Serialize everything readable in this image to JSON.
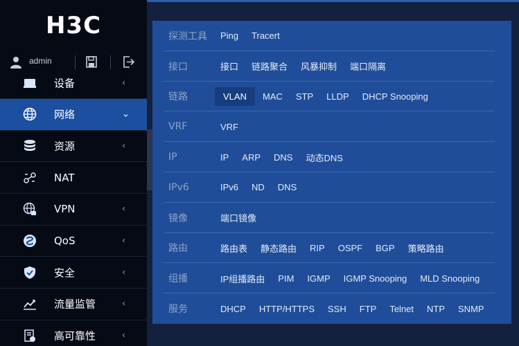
{
  "brand": {
    "logo_text": "H3C"
  },
  "user": {
    "name": "admin",
    "icon": "user-icon",
    "save_icon": "save-icon",
    "logout_icon": "logout-icon"
  },
  "sidebar": {
    "items": [
      {
        "label": "设备",
        "icon": "device-icon",
        "chevron": "‹"
      },
      {
        "label": "网络",
        "icon": "globe-icon",
        "chevron": "⌄",
        "active": true
      },
      {
        "label": "资源",
        "icon": "database-icon",
        "chevron": "‹"
      },
      {
        "label": "NAT",
        "icon": "nat-icon",
        "chevron": ""
      },
      {
        "label": "VPN",
        "icon": "vpn-globe-icon",
        "chevron": "‹"
      },
      {
        "label": "QoS",
        "icon": "qos-icon",
        "chevron": "‹"
      },
      {
        "label": "安全",
        "icon": "shield-icon",
        "chevron": "‹"
      },
      {
        "label": "流量监管",
        "icon": "traffic-chart-icon",
        "chevron": "‹"
      },
      {
        "label": "高可靠性",
        "icon": "reliability-icon",
        "chevron": "‹"
      }
    ]
  },
  "panel": {
    "rows": [
      {
        "label": "探测工具",
        "items": [
          "Ping",
          "Tracert"
        ]
      },
      {
        "label": "接口",
        "items": [
          "接口",
          "链路聚合",
          "风暴抑制",
          "端口隔离"
        ]
      },
      {
        "label": "链路",
        "items": [
          "VLAN",
          "MAC",
          "STP",
          "LLDP",
          "DHCP Snooping"
        ],
        "selected": "VLAN"
      },
      {
        "label": "VRF",
        "items": [
          "VRF"
        ]
      },
      {
        "label": "IP",
        "items": [
          "IP",
          "ARP",
          "DNS",
          "动态DNS"
        ]
      },
      {
        "label": "IPv6",
        "items": [
          "IPv6",
          "ND",
          "DNS"
        ]
      },
      {
        "label": "镜像",
        "items": [
          "端口镜像"
        ]
      },
      {
        "label": "路由",
        "items": [
          "路由表",
          "静态路由",
          "RIP",
          "OSPF",
          "BGP",
          "策略路由"
        ]
      },
      {
        "label": "组播",
        "items": [
          "IP组播路由",
          "PIM",
          "IGMP",
          "IGMP Snooping",
          "MLD Snooping"
        ]
      },
      {
        "label": "服务",
        "items": [
          "DHCP",
          "HTTP/HTTPS",
          "SSH",
          "FTP",
          "Telnet",
          "NTP",
          "SNMP"
        ]
      }
    ]
  },
  "colors": {
    "sidebar_bg": "#050a14",
    "active_item": "#1d4fa0",
    "panel_bg": "#1f4d99",
    "selected_bg": "#163d7e",
    "page_bg": "#13213f"
  }
}
